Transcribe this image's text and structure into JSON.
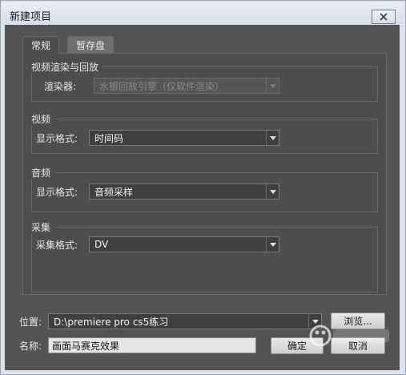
{
  "window": {
    "title": "新建项目"
  },
  "tabs": [
    {
      "label": "常规",
      "active": true
    },
    {
      "label": "暂存盘",
      "active": false
    }
  ],
  "groups": {
    "playback": {
      "title": "视频渲染与回放",
      "renderer_label": "渲染器:",
      "renderer_value": "水银回放引擎（仅软件渲染）",
      "renderer_disabled": true
    },
    "video": {
      "title": "视频",
      "display_format_label": "显示格式:",
      "display_format_value": "时间码"
    },
    "audio": {
      "title": "音频",
      "display_format_label": "显示格式:",
      "display_format_value": "音频采样"
    },
    "capture": {
      "title": "采集",
      "capture_format_label": "采集格式:",
      "capture_format_value": "DV"
    }
  },
  "location": {
    "label": "位置:",
    "value": "D:\\premiere pro cs5练习",
    "browse_label": "浏览..."
  },
  "name": {
    "label": "名称:",
    "value": "画面马赛克效果"
  },
  "buttons": {
    "ok_label": "确定",
    "cancel_label": "取消"
  },
  "colors": {
    "panel_bg": "#535353",
    "tab_panel_bg": "#4d4d4d",
    "titlebar_bg": "#dbe4ee"
  }
}
